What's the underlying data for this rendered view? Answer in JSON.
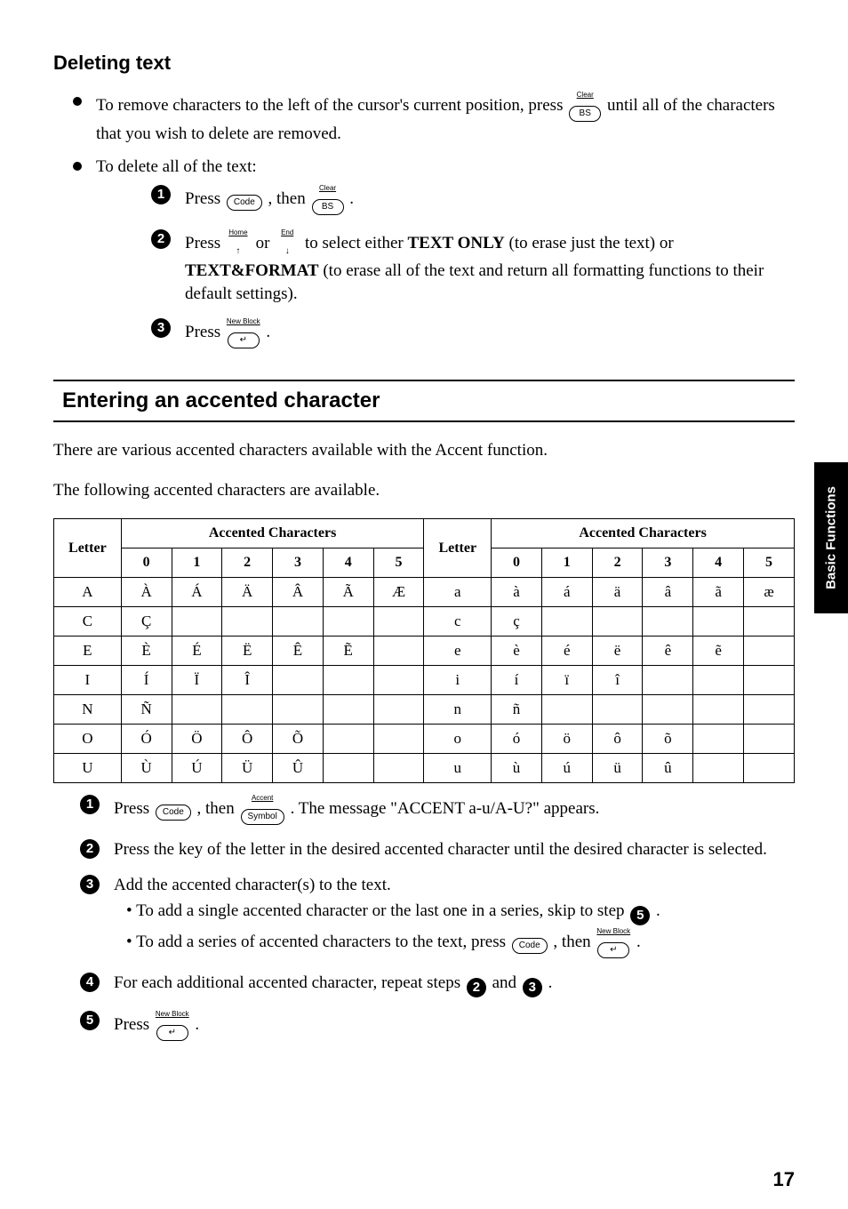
{
  "side_tab": "Basic Functions",
  "page_number": "17",
  "sections": {
    "deleting": {
      "title": "Deleting text",
      "bullet1_pre": "To remove characters to the left of the cursor's current position, press ",
      "bullet1_post": " until all of the characters that you wish to delete are removed.",
      "bullet2": "To delete all of the text:",
      "step1_a": "Press ",
      "step1_b": ", then ",
      "step1_c": ".",
      "step2_a": "Press ",
      "step2_b": " or ",
      "step2_c": " to select either ",
      "step2_textonly": "TEXT ONLY",
      "step2_d": " (to erase just the text) or ",
      "step2_textformat": "TEXT&FORMAT",
      "step2_e": " (to erase all of the text and return all formatting functions to their default settings).",
      "step3_a": "Press ",
      "step3_b": "."
    },
    "accent": {
      "title": "Entering an accented character",
      "intro1": "There are various accented characters available with the Accent function.",
      "intro2": "The following accented characters are available.",
      "table": {
        "header_letter": "Letter",
        "header_acc": "Accented Characters",
        "cols": [
          "0",
          "1",
          "2",
          "3",
          "4",
          "5"
        ],
        "rows_upper": [
          {
            "letter": "A",
            "cells": [
              "À",
              "Á",
              "Ä",
              "Â",
              "Ã",
              "Æ"
            ]
          },
          {
            "letter": "C",
            "cells": [
              "Ç",
              "",
              "",
              "",
              "",
              ""
            ]
          },
          {
            "letter": "E",
            "cells": [
              "È",
              "É",
              "Ë",
              "Ê",
              "Ẽ",
              ""
            ]
          },
          {
            "letter": "I",
            "cells": [
              "Í",
              "Ï",
              "Î",
              "",
              "",
              ""
            ]
          },
          {
            "letter": "N",
            "cells": [
              "Ñ",
              "",
              "",
              "",
              "",
              ""
            ]
          },
          {
            "letter": "O",
            "cells": [
              "Ó",
              "Ö",
              "Ô",
              "Õ",
              "",
              ""
            ]
          },
          {
            "letter": "U",
            "cells": [
              "Ù",
              "Ú",
              "Ü",
              "Û",
              "",
              ""
            ]
          }
        ],
        "rows_lower": [
          {
            "letter": "a",
            "cells": [
              "à",
              "á",
              "ä",
              "â",
              "ã",
              "æ"
            ]
          },
          {
            "letter": "c",
            "cells": [
              "ç",
              "",
              "",
              "",
              "",
              ""
            ]
          },
          {
            "letter": "e",
            "cells": [
              "è",
              "é",
              "ë",
              "ê",
              "ẽ",
              ""
            ]
          },
          {
            "letter": "i",
            "cells": [
              "í",
              "ï",
              "î",
              "",
              "",
              ""
            ]
          },
          {
            "letter": "n",
            "cells": [
              "ñ",
              "",
              "",
              "",
              "",
              ""
            ]
          },
          {
            "letter": "o",
            "cells": [
              "ó",
              "ö",
              "ô",
              "õ",
              "",
              ""
            ]
          },
          {
            "letter": "u",
            "cells": [
              "ù",
              "ú",
              "ü",
              "û",
              "",
              ""
            ]
          }
        ]
      },
      "step1_a": "Press ",
      "step1_b": ", then ",
      "step1_c": ". The message \"ACCENT a-u/A-U?\" appears.",
      "step2": "Press the key of the letter in the desired accented character until the desired character is selected.",
      "step3": "Add the accented character(s) to the text.",
      "step3_sub1_a": "To add a single accented character or the last one in a series, skip to step ",
      "step3_sub1_b": ".",
      "step3_sub2_a": "To add a series of accented characters to the text, press ",
      "step3_sub2_b": ", then ",
      "step3_sub2_c": ".",
      "step4_a": "For each additional accented character, repeat steps ",
      "step4_b": " and ",
      "step4_c": ".",
      "step5_a": "Press ",
      "step5_b": "."
    }
  },
  "keys": {
    "code": "Code",
    "bs": "BS",
    "clear": "Clear",
    "home": "Home",
    "end": "End",
    "newblock": "New Block",
    "accent": "Accent",
    "symbol": "Symbol",
    "enter": "↵",
    "up": "↑",
    "down": "↓"
  }
}
